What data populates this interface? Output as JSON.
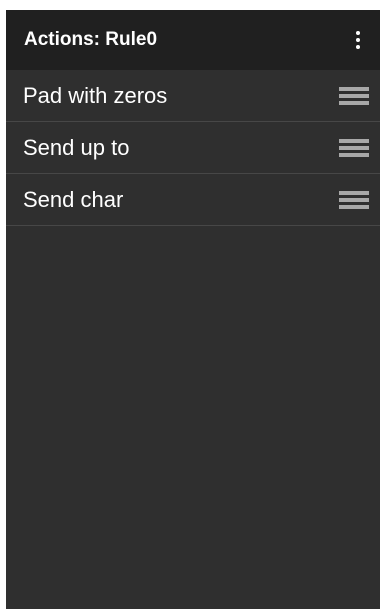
{
  "app_bar": {
    "title": "Actions: Rule0",
    "overflow_icon": "more-vert-icon"
  },
  "actions": [
    {
      "label": "Pad with zeros",
      "handle_icon": "drag-handle-icon"
    },
    {
      "label": "Send up to",
      "handle_icon": "drag-handle-icon"
    },
    {
      "label": "Send char",
      "handle_icon": "drag-handle-icon"
    }
  ],
  "colors": {
    "app_bar_background": "#202020",
    "list_background": "#2f2f2f",
    "divider": "#474747",
    "text": "#ffffff",
    "handle": "#a8a8a8"
  }
}
